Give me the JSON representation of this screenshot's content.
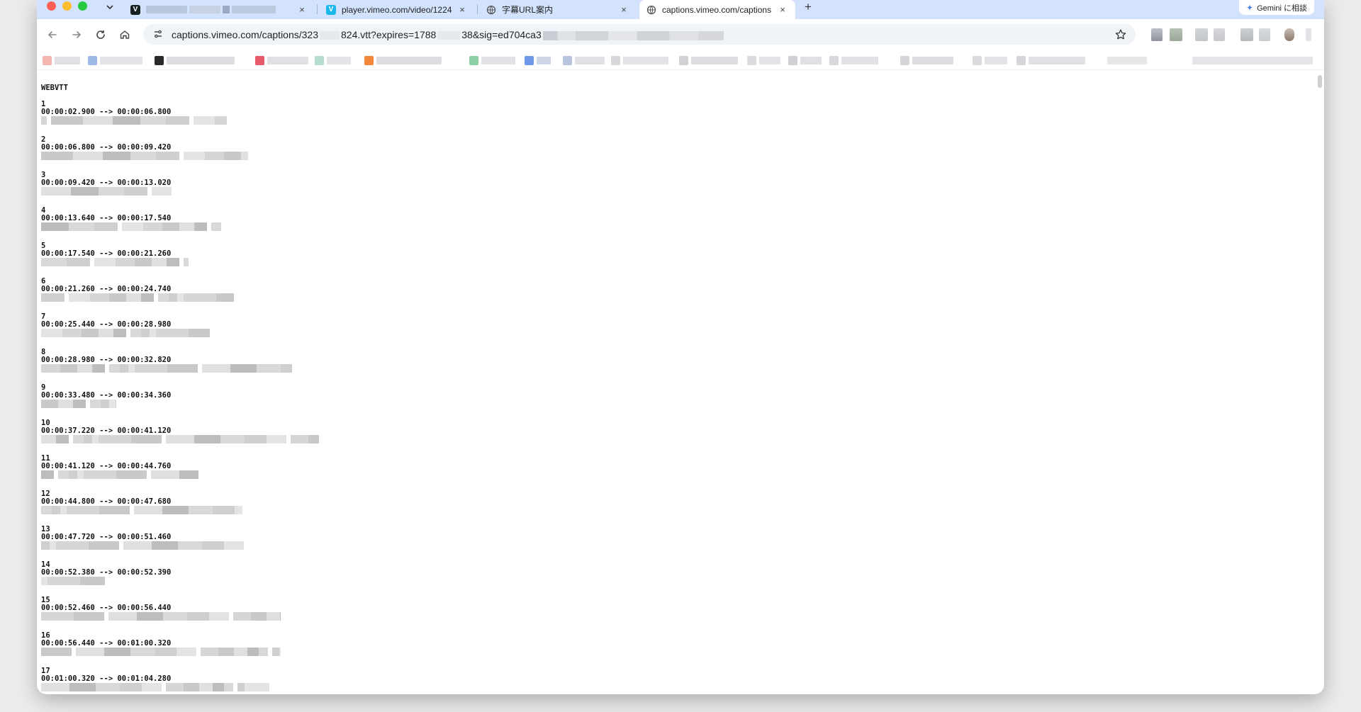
{
  "tabs": [
    {
      "label": "",
      "favicon": "vimeo-dark-v",
      "active": false,
      "close": "×"
    },
    {
      "label": "player.vimeo.com/video/1224",
      "favicon": "vimeo-blue-v",
      "active": false,
      "close": "×"
    },
    {
      "label": "字幕URL案内",
      "favicon": "globe-icon",
      "active": false,
      "close": "×"
    },
    {
      "label": "captions.vimeo.com/captions",
      "favicon": "globe-icon",
      "active": true,
      "close": "×"
    }
  ],
  "new_tab": "+",
  "gemini_label": "Gemini に相談",
  "address": {
    "url_part1": "captions.vimeo.com/captions/323",
    "url_part2": "824.vtt?expires=1788",
    "url_part3": "38&sig=ed704ca3"
  },
  "vimeo_logo_letter": "V",
  "document": {
    "header": "WEBVTT",
    "cues": [
      {
        "id": "1",
        "time": "00:00:02.900 --> 00:00:06.800"
      },
      {
        "id": "2",
        "time": "00:00:06.800 --> 00:00:09.420"
      },
      {
        "id": "3",
        "time": "00:00:09.420 --> 00:00:13.020"
      },
      {
        "id": "4",
        "time": "00:00:13.640 --> 00:00:17.540"
      },
      {
        "id": "5",
        "time": "00:00:17.540 --> 00:00:21.260"
      },
      {
        "id": "6",
        "time": "00:00:21.260 --> 00:00:24.740"
      },
      {
        "id": "7",
        "time": "00:00:25.440 --> 00:00:28.980"
      },
      {
        "id": "8",
        "time": "00:00:28.980 --> 00:00:32.820"
      },
      {
        "id": "9",
        "time": "00:00:33.480 --> 00:00:34.360"
      },
      {
        "id": "10",
        "time": "00:00:37.220 --> 00:00:41.120"
      },
      {
        "id": "11",
        "time": "00:00:41.120 --> 00:00:44.760"
      },
      {
        "id": "12",
        "time": "00:00:44.800 --> 00:00:47.680"
      },
      {
        "id": "13",
        "time": "00:00:47.720 --> 00:00:51.460"
      },
      {
        "id": "14",
        "time": "00:00:52.380 --> 00:00:52.390"
      },
      {
        "id": "15",
        "time": "00:00:52.460 --> 00:00:56.440"
      },
      {
        "id": "16",
        "time": "00:00:56.440 --> 00:01:00.320"
      },
      {
        "id": "17",
        "time": "00:01:00.320 --> 00:01:04.280"
      }
    ]
  },
  "colors": {
    "tabstrip": "#d3e3fd",
    "omnibox": "#f0f4f9",
    "vimeo_blue": "#1ab7ea",
    "vimeo_dark": "#162221"
  },
  "icons": {
    "back": "arrow-left-icon",
    "forward": "arrow-right-icon",
    "reload": "reload-icon",
    "home": "home-icon",
    "site_info": "tune-icon",
    "bookmark": "star-icon",
    "gemini": "sparkle-icon"
  }
}
